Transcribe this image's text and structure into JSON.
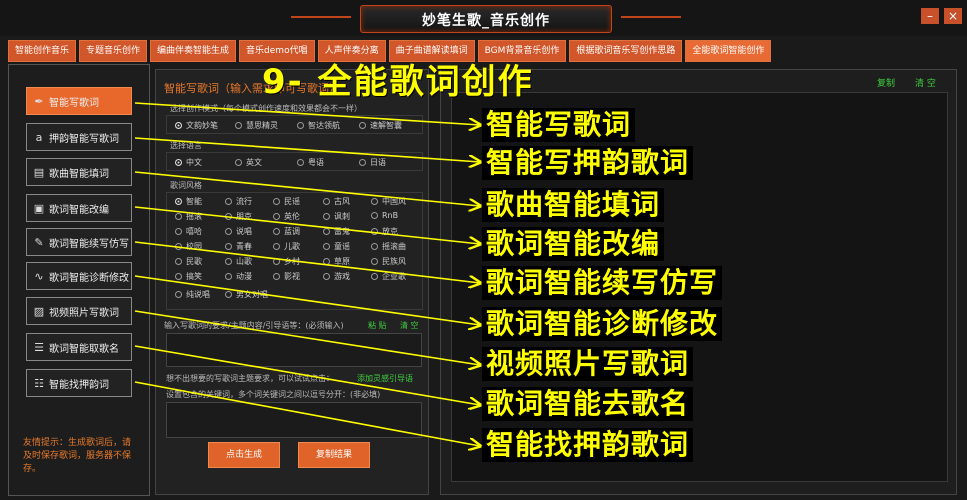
{
  "window": {
    "title": "妙笔生歌_音乐创作",
    "minimize": "–",
    "close": "×"
  },
  "tabs": [
    "智能创作音乐",
    "专题音乐创作",
    "编曲伴奏智能生成",
    "音乐demo代唱",
    "人声伴奏分离",
    "曲子曲谱解读填词",
    "BGM背景音乐创作",
    "根据歌词音乐写创作思路",
    "全能歌词智能创作"
  ],
  "sidebar": {
    "items": [
      {
        "label": "智能写歌词",
        "icon": "pen-icon"
      },
      {
        "label": "押韵智能写歌词",
        "icon": "letter-a-icon"
      },
      {
        "label": "歌曲智能填词",
        "icon": "document-icon"
      },
      {
        "label": "歌词智能改编",
        "icon": "edit-icon"
      },
      {
        "label": "歌词智能续写仿写",
        "icon": "pencil-icon"
      },
      {
        "label": "歌词智能诊断修改",
        "icon": "wave-icon"
      },
      {
        "label": "视频照片写歌词",
        "icon": "image-icon"
      },
      {
        "label": "歌词智能取歌名",
        "icon": "list-icon"
      },
      {
        "label": "智能找押韵词",
        "icon": "sliders-icon"
      }
    ],
    "tip": "友情提示：生成歌词后，请及时保存歌词，服务器不保存。"
  },
  "form": {
    "title": "智能写歌词（输入需求即可写歌词）",
    "mode_label": "选择创作模式（每个模式创作速度和效果都会不一样）",
    "modes": [
      "文韵妙笔",
      "慧思精灵",
      "智达领航",
      "速解智囊"
    ],
    "lang_label": "选择语言",
    "langs": [
      "中文",
      "英文",
      "粤语",
      "日语"
    ],
    "style_label": "歌词风格",
    "styles": [
      "智能",
      "流行",
      "民谣",
      "古风",
      "中国风",
      "摇滚",
      "朋克",
      "英伦",
      "讽刺",
      "RnB",
      "嘻哈",
      "说唱",
      "蓝调",
      "雷鬼",
      "放克",
      "校园",
      "青春",
      "儿歌",
      "童谣",
      "摇滚曲",
      "民歌",
      "山歌",
      "乡村",
      "草原",
      "民族风",
      "搞笑",
      "动漫",
      "影视",
      "游戏",
      "企业歌",
      "纯说唱",
      "男女对唱"
    ],
    "input_label": "输入写歌词的要求/主题内容/引导语等：(必须输入)",
    "paste": "粘 贴",
    "clear": "清 空",
    "hint1": "想不出想要的写歌词主题要求，可以试试点击：",
    "hint_link": "添加灵感引导语",
    "hint2": "设置包含的关键词，多个词关键词之间以逗号分开：(非必填)",
    "generate": "点击生成",
    "copy_result": "复制结果"
  },
  "result": {
    "copy": "复制",
    "clear": "清 空"
  },
  "overlay": {
    "title": "9- 全能歌词创作",
    "captions": [
      "智能写歌词",
      "智能写押韵歌词",
      "歌曲智能填词",
      "歌词智能改编",
      "歌词智能续写仿写",
      "歌词智能诊断修改",
      "视频照片写歌词",
      "歌词智能去歌名",
      "智能找押韵歌词"
    ]
  },
  "colors": {
    "accent": "#e8682c",
    "caption": "#ffff00",
    "link": "#3fcf3f"
  }
}
